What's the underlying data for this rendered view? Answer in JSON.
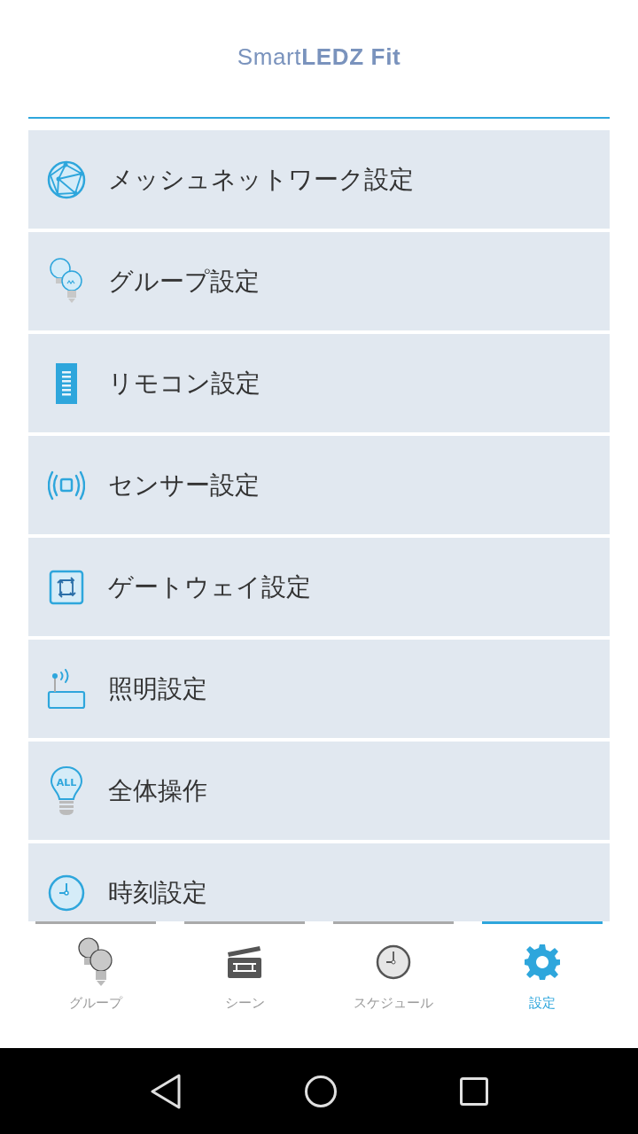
{
  "header": {
    "logo": "Smart**LEDZ Fit**"
  },
  "menu": [
    {
      "kind": "network",
      "label": "メッシュネットワーク設定"
    },
    {
      "kind": "group",
      "label": "グループ設定"
    },
    {
      "kind": "remote",
      "label": "リモコン設定"
    },
    {
      "kind": "sensor",
      "label": "センサー設定"
    },
    {
      "kind": "gateway",
      "label": "ゲートウェイ設定"
    },
    {
      "kind": "light",
      "label": "照明設定"
    },
    {
      "kind": "all",
      "label": "全体操作",
      "icon_text": "ALL"
    },
    {
      "kind": "clock",
      "label": "時刻設定"
    }
  ],
  "tab_bar": [
    {
      "kind": "group",
      "label": "グループ",
      "selected": false
    },
    {
      "kind": "scene",
      "label": "シーン",
      "selected": false
    },
    {
      "kind": "schedule",
      "label": "スケジュール",
      "selected": false
    },
    {
      "kind": "settings",
      "label": "設定",
      "selected": true
    }
  ]
}
